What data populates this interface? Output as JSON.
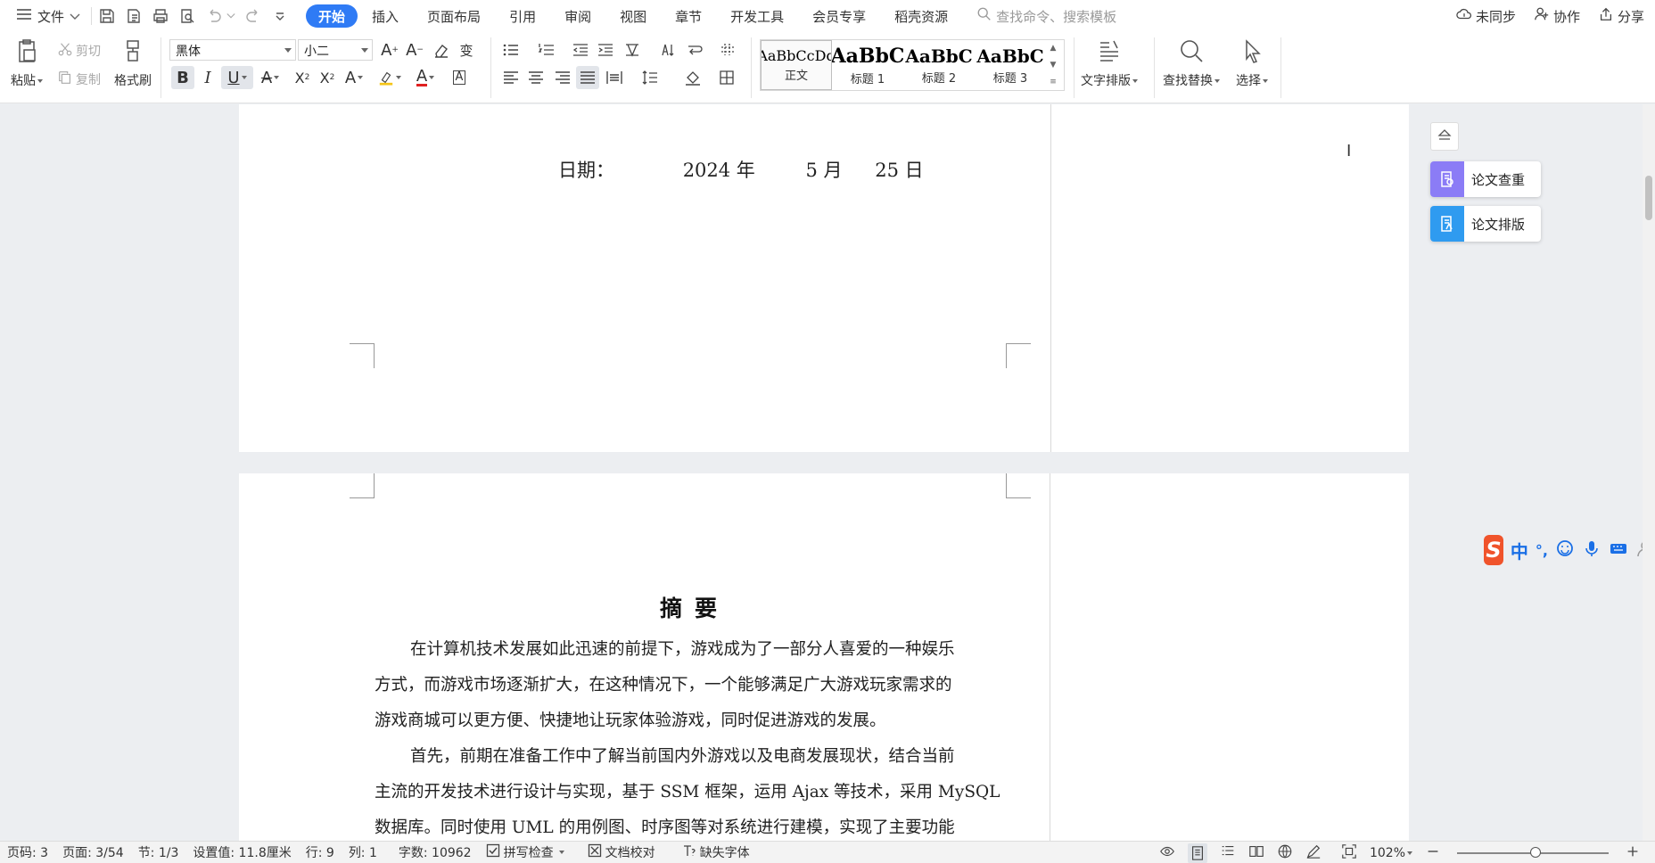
{
  "menubar": {
    "file_label": "文件",
    "tabs": [
      {
        "label": "开始",
        "active": true
      },
      {
        "label": "插入"
      },
      {
        "label": "页面布局"
      },
      {
        "label": "引用"
      },
      {
        "label": "审阅"
      },
      {
        "label": "视图"
      },
      {
        "label": "章节"
      },
      {
        "label": "开发工具"
      },
      {
        "label": "会员专享"
      },
      {
        "label": "稻壳资源"
      }
    ],
    "search_placeholder": "查找命令、搜索模板",
    "right": {
      "sync": "未同步",
      "collab": "协作",
      "share": "分享"
    }
  },
  "ribbon": {
    "paste": "粘贴",
    "cut": "剪切",
    "copy": "复制",
    "format_painter": "格式刷",
    "font_name": "黑体",
    "font_size": "小二",
    "styles": [
      {
        "preview": "AaBbCcDd",
        "label": "正文"
      },
      {
        "preview": "AaBbC",
        "label": "标题 1"
      },
      {
        "preview": "AaBbC",
        "label": "标题 2"
      },
      {
        "preview": "AaBbC",
        "label": "标题 3"
      }
    ],
    "text_layout": "文字排版",
    "find_replace": "查找替换",
    "select": "选择"
  },
  "document": {
    "date_label": "日期：",
    "date_year": "2024 年",
    "date_month": "5 月",
    "date_day": "25 日",
    "abstract_title": "摘要",
    "lines": [
      "在计算机技术发展如此迅速的前提下，游戏成为了一部分人喜爱的一种娱乐",
      "方式，而游戏市场逐渐扩大，在这种情况下，一个能够满足广大游戏玩家需求的",
      "游戏商城可以更方便、快捷地让玩家体验游戏，同时促进游戏的发展。",
      "首先，前期在准备工作中了解当前国内外游戏以及电商发展现状，结合当前",
      "主流的开发技术进行设计与实现，基于 SSM 框架，运用 Ajax 等技术，采用 MySQL",
      "数据库。同时使用 UML 的用例图、时序图等对系统进行建模，实现了主要功能"
    ]
  },
  "side_panel": {
    "check": "论文查重",
    "layout": "论文排版",
    "check_color": "#8b7cf6",
    "layout_color": "#2f9bf0"
  },
  "ime": {
    "lang": "中",
    "punct": "°,"
  },
  "statusbar": {
    "page_code": "页码: 3",
    "page": "页面: 3/54",
    "section": "节: 1/3",
    "setting": "设置值: 11.8厘米",
    "row": "行: 9",
    "col": "列: 1",
    "words": "字数: 10962",
    "spell": "拼写检查",
    "proof": "文档校对",
    "missing_font": "缺失字体",
    "zoom": "102%",
    "zoom_level": 0.52
  }
}
